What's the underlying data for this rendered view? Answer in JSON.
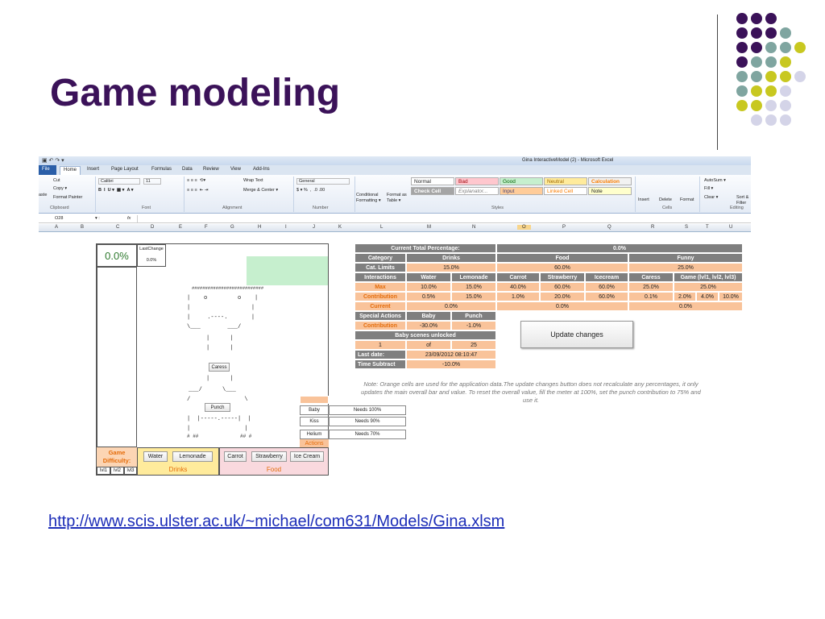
{
  "slide": {
    "title": "Game modeling",
    "link": "http://www.scis.ulster.ac.uk/~michael/com631/Models/Gina.xlsm"
  },
  "colors": {
    "title": "#3b1259",
    "purple": "#3b1259",
    "teal": "#7fa5a0",
    "olive": "#c8c820",
    "lavender": "#d4d4e8",
    "orange_cell": "#f9c39a",
    "gray_header": "#7f7f7f"
  },
  "excel": {
    "window_title": "Gina InteractiveModel (2) - Microsoft Excel",
    "tabs": [
      "File",
      "Home",
      "Insert",
      "Page Layout",
      "Formulas",
      "Data",
      "Review",
      "View",
      "Add-Ins"
    ],
    "ribbon": {
      "cut": "Cut",
      "copy": "Copy ▾",
      "format_painter": "Format Painter",
      "paste": "aste",
      "font_name": "Calibri",
      "font_size": "11",
      "wrap_text": "Wrap Text",
      "merge_center": "Merge & Center ▾",
      "number_format": "General",
      "conditional": "Conditional Formatting ▾",
      "format_as_table": "Format as Table ▾",
      "styles": {
        "normal": "Normal",
        "bad": "Bad",
        "good": "Good",
        "neutral": "Neutral",
        "calculation": "Calculation",
        "check_cell": "Check Cell",
        "explanatory": "Explanator...",
        "input": "Input",
        "linked_cell": "Linked Cell",
        "note": "Note"
      },
      "insert": "Insert",
      "delete": "Delete",
      "format": "Format",
      "autosum": "AutoSum ▾",
      "fill": "Fill ▾",
      "clear": "Clear ▾",
      "sort": "Sort & Filter",
      "groups": [
        "Clipboard",
        "Font",
        "Alignment",
        "Number",
        "Styles",
        "Cells",
        "Editing"
      ]
    },
    "name_box": "O28",
    "fx": "fx",
    "columns": [
      "A",
      "B",
      "C",
      "D",
      "E",
      "F",
      "G",
      "H",
      "I",
      "J",
      "K",
      "L",
      "M",
      "N",
      "O",
      "P",
      "Q",
      "R",
      "S",
      "T",
      "U"
    ],
    "left_panel": {
      "meter_value": "0.0%",
      "last_change_label": "LastChange",
      "last_change_value": "0.0%",
      "hashes": "###########################",
      "eyes": "|    o         o    |",
      "caress_button": "Caress",
      "punch_button": "Punch",
      "hash_left": "# ##",
      "hash_right": "## #",
      "game_difficulty": "Game Difficulty:",
      "levels": [
        "lvl1",
        "lvl2",
        "lvl3"
      ],
      "drinks_buttons": [
        "Water",
        "Lemonade"
      ],
      "drinks_label": "Drinks",
      "food_buttons": [
        "Carrot",
        "Strawberry",
        "Ice Cream"
      ],
      "food_label": "Food",
      "actions": [
        {
          "name": "Baby",
          "needs": "Needs 100%"
        },
        {
          "name": "Kiss",
          "needs": "Needs 90%"
        },
        {
          "name": "Helium",
          "needs": "Needs 70%"
        }
      ],
      "actions_label": "Actions"
    },
    "table": {
      "current_total_label": "Current Total Percentage:",
      "current_total_value": "0.0%",
      "category_label": "Category",
      "categories": [
        "Drinks",
        "Food",
        "Funny"
      ],
      "cat_limits_label": "Cat. Limits",
      "cat_limits": [
        "15.0%",
        "60.0%",
        "25.0%"
      ],
      "interactions_label": "Interactions",
      "interactions": [
        "Water",
        "Lemonade",
        "Carrot",
        "Strawberry",
        "Icecream",
        "Caress",
        "Game (lvl1, lvl2, lvl3)"
      ],
      "max_label": "Max",
      "max": [
        "10.0%",
        "15.0%",
        "40.0%",
        "60.0%",
        "60.0%",
        "25.0%",
        "25.0%"
      ],
      "contribution_label": "Contribution",
      "contribution": [
        "0.5%",
        "15.0%",
        "1.0%",
        "20.0%",
        "60.0%",
        "0.1%",
        "2.0%",
        "4.0%",
        "10.0%"
      ],
      "current_label": "Current",
      "current": [
        "0.0%",
        "0.0%",
        "0.0%"
      ],
      "special_actions_label": "Special Actions",
      "special_actions": [
        "Baby",
        "Punch"
      ],
      "special_contribution_label": "Contribution",
      "special_contribution": [
        "-30.0%",
        "-1.0%"
      ],
      "baby_scenes_label": "Baby scenes unlocked",
      "baby_scenes": [
        "1",
        "of",
        "25"
      ],
      "last_date_label": "Last date:",
      "last_date": "23/09/2012 08:10:47",
      "time_subtract_label": "Time Subtract",
      "time_subtract": "-10.0%",
      "update_button": "Update changes",
      "note": "Note: Orange cells are used for the application data.The update changes button does not recalculate any percentages, it only updates the main overall bar and value. To reset the overall value, fill the meter at 100%, set the punch contribution to 75% and use it."
    }
  }
}
